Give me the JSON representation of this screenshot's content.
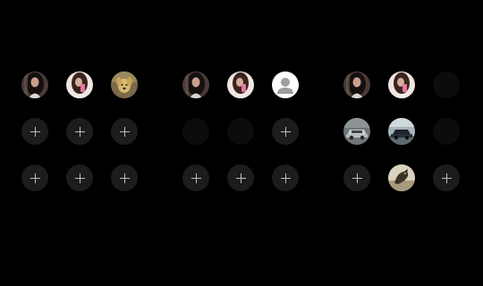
{
  "panels": [
    {
      "slots": [
        [
          "photo-woman-dark",
          "photo-woman-light",
          "photo-dog"
        ],
        [
          "add",
          "add",
          "add"
        ],
        [
          "add",
          "add",
          "add"
        ]
      ]
    },
    {
      "slots": [
        [
          "photo-woman-dark",
          "photo-woman-light",
          "default-avatar"
        ],
        [
          "empty",
          "empty",
          "add"
        ],
        [
          "add",
          "add",
          "add"
        ]
      ]
    },
    {
      "slots": [
        [
          "photo-woman-dark",
          "photo-woman-light",
          "empty"
        ],
        [
          "photo-car-silver",
          "photo-car-dark",
          "empty"
        ],
        [
          "add",
          "photo-bird",
          "add"
        ]
      ]
    }
  ],
  "colors": {
    "background": "#000000",
    "add_slot": "#1c1c1c",
    "empty_slot": "#0c0c0c",
    "plus": "#bdbdbd",
    "default_avatar_bg": "#ffffff",
    "default_avatar_figure": "#9e9e9e"
  },
  "icons": {
    "add": "plus-icon",
    "default-avatar": "person-icon"
  }
}
